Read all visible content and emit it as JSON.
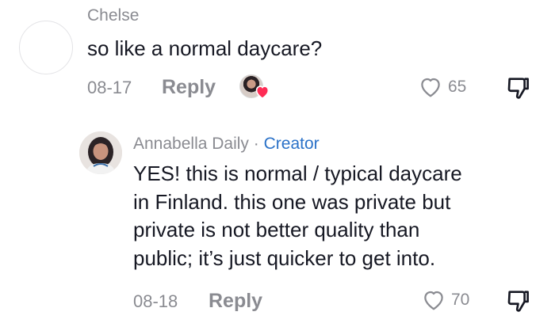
{
  "comments": [
    {
      "author": "Chelse",
      "text": "so like a normal daycare?",
      "date": "08-17",
      "reply_label": "Reply",
      "likes": "65",
      "creator_liked": true
    },
    {
      "author": "Annabella Daily",
      "separator": " · ",
      "badge": "Creator",
      "text_lines": [
        "YES! this is normal / typical daycare",
        "in Finland. this one was private but",
        "private is not better quality than",
        "public; it’s just quicker to get into."
      ],
      "date": "08-18",
      "reply_label": "Reply",
      "likes": "70"
    }
  ],
  "icons": {
    "like": "heart-outline-icon",
    "dislike": "thumbs-down-outline-icon",
    "creator_like": "creator-heart-icon"
  },
  "colors": {
    "text": "#161823",
    "muted": "#8a8b91",
    "creator": "#2b72c8",
    "heart": "#fe2c55"
  }
}
